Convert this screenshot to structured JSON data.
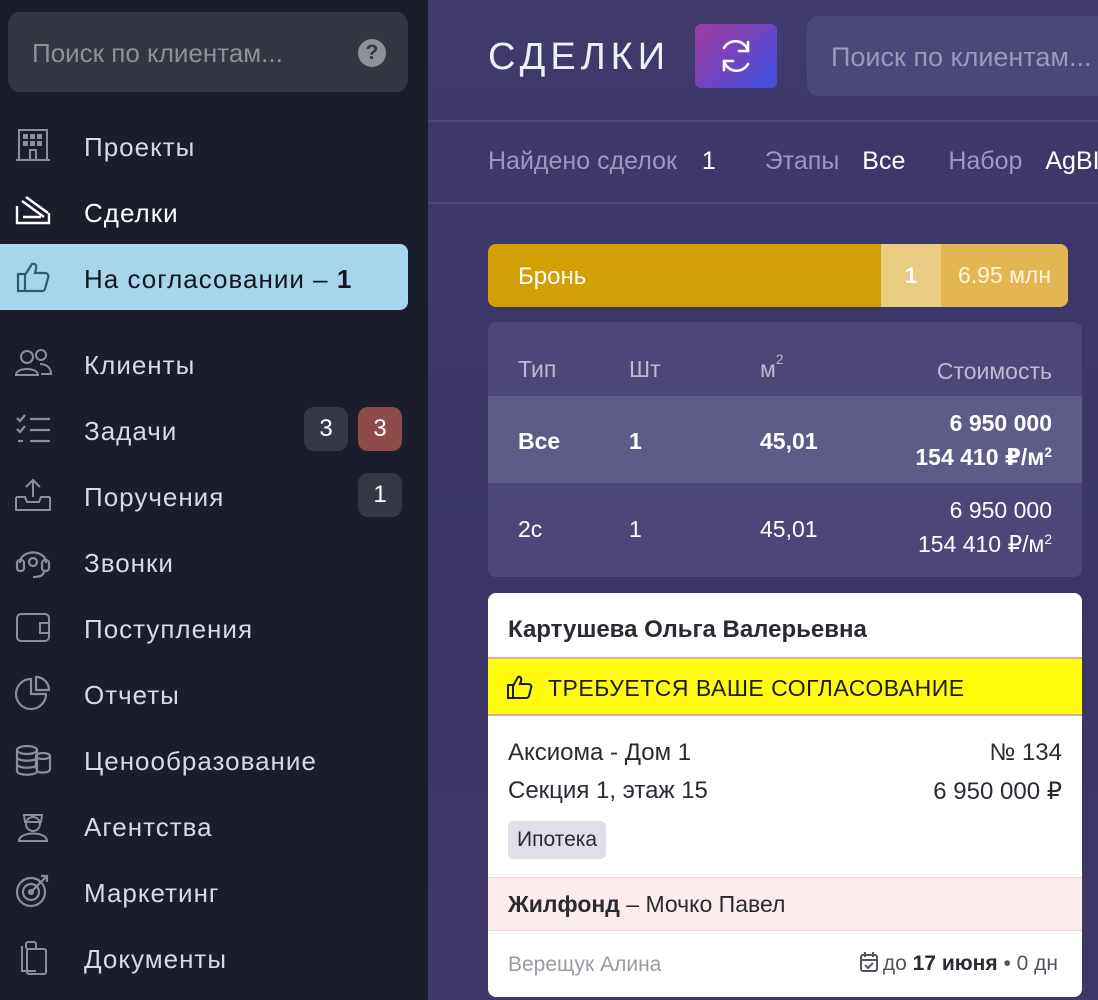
{
  "sidebar": {
    "search_placeholder": "Поиск по клиентам...",
    "help_label": "?",
    "items": [
      {
        "label": "Проекты",
        "icon": "building-icon"
      },
      {
        "label": "Сделки",
        "icon": "signature-icon"
      },
      {
        "label": "На согласовании – ",
        "count": "1",
        "icon": "thumbs-up-icon",
        "active": true
      },
      {
        "label": "Клиенты",
        "icon": "users-icon"
      },
      {
        "label": "Задачи",
        "icon": "task-list-icon",
        "badge1": "3",
        "badge2": "3"
      },
      {
        "label": "Поручения",
        "icon": "inbox-upload-icon",
        "badge1": "1"
      },
      {
        "label": "Звонки",
        "icon": "headset-icon"
      },
      {
        "label": "Поступления",
        "icon": "wallet-icon"
      },
      {
        "label": "Отчеты",
        "icon": "pie-chart-icon"
      },
      {
        "label": "Ценообразование",
        "icon": "coins-icon"
      },
      {
        "label": "Агентства",
        "icon": "agent-icon"
      },
      {
        "label": "Маркетинг",
        "icon": "target-icon"
      },
      {
        "label": "Документы",
        "icon": "documents-icon"
      }
    ]
  },
  "header": {
    "title": "СДЕЛКИ",
    "search_placeholder": "Поиск по клиентам..."
  },
  "filters": {
    "found_label": "Найдено сделок",
    "found_value": "1",
    "stages_label": "Этапы",
    "stages_value": "Все",
    "set_label": "Набор",
    "set_value": "AgBI"
  },
  "stage": {
    "name": "Бронь",
    "count": "1",
    "sum": "6.95 млн",
    "color": "#d29f04"
  },
  "summary_table": {
    "headers": {
      "type": "Тип",
      "qty": "Шт",
      "area": "м",
      "area_sup": "2",
      "cost": "Стоимость"
    },
    "rows": [
      {
        "type": "Все",
        "qty": "1",
        "area": "45,01",
        "cost": "6 950 000",
        "price_m2": "154 410 ₽/м",
        "sup": "2"
      },
      {
        "type": "2с",
        "qty": "1",
        "area": "45,01",
        "cost": "6 950 000",
        "price_m2": "154 410 ₽/м",
        "sup": "2"
      }
    ]
  },
  "deal_card": {
    "client": "Картушева Ольга Валерьевна",
    "alert": "ТРЕБУЕТСЯ ВАШЕ СОГЛАСОВАНИЕ",
    "project": "Аксиома - Дом 1",
    "number": "№ 134",
    "location": "Секция 1, этаж 15",
    "price": "6 950 000 ₽",
    "tag": "Ипотека",
    "agency": "Жилфонд",
    "agent": " – Мочко Павел",
    "manager": "Верещук Алина",
    "due_prefix": "до ",
    "due_date": "17 июня",
    "due_suffix": " • 0 дн"
  }
}
